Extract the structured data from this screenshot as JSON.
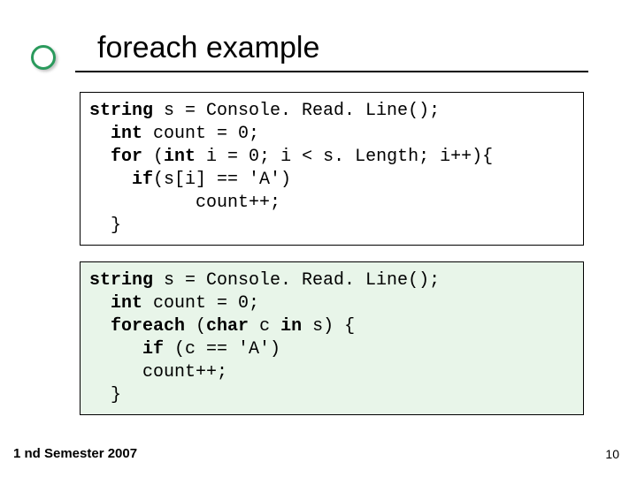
{
  "slide": {
    "title": "foreach example",
    "footer_left": "1 nd Semester 2007",
    "footer_right": "10"
  },
  "code1": {
    "l1a": "string",
    "l1b": " s = Console. Read. Line();",
    "l2a": "  int",
    "l2b": " count = 0;",
    "l3a": "  for",
    "l3b": " (",
    "l3c": "int",
    "l3d": " i = 0; i < s. Length; i++){",
    "l4a": "    if",
    "l4b": "(s[i] == 'A')",
    "l5": "          count++;",
    "l6": "  }"
  },
  "code2": {
    "l1a": "string",
    "l1b": " s = Console. Read. Line();",
    "l2a": "  int",
    "l2b": " count = 0;",
    "l3a": "  foreach",
    "l3b": " (",
    "l3c": "char",
    "l3d": " c ",
    "l3e": "in",
    "l3f": " s) {",
    "l4a": "     if",
    "l4b": " (c == 'A')",
    "l5": "     count++;",
    "l6": "  }"
  }
}
